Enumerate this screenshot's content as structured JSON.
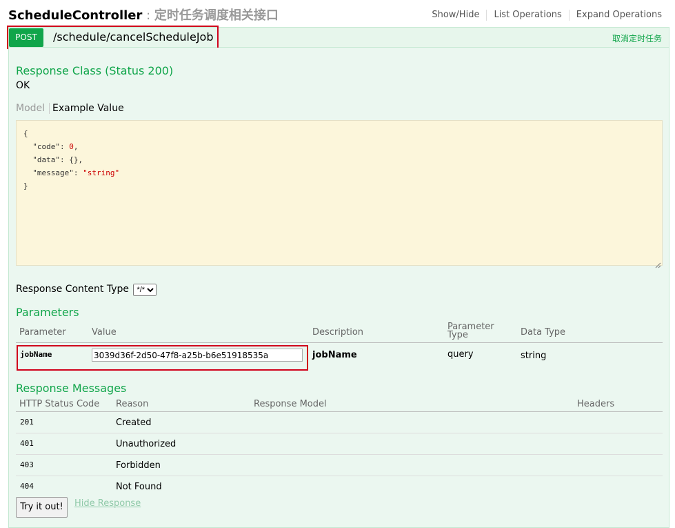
{
  "header": {
    "controller": "ScheduleController",
    "separator": " : ",
    "description": "定时任务调度相关接口",
    "links": [
      "Show/Hide",
      "List Operations",
      "Expand Operations"
    ]
  },
  "operation": {
    "method": "POST",
    "path": "/schedule/cancelScheduleJob",
    "summary": "取消定时任务"
  },
  "response_class": {
    "title": "Response Class (Status 200)",
    "status_text": "OK",
    "tab_model": "Model",
    "tab_example": "Example Value"
  },
  "example_json": {
    "open": "{",
    "code_key": "\"code\"",
    "code_val": "0",
    "data_key": "\"data\"",
    "data_val": "{}",
    "message_key": "\"message\"",
    "message_val": "\"string\"",
    "close": "}"
  },
  "response_content_type": {
    "label": "Response Content Type",
    "selected": "*/*"
  },
  "parameters": {
    "title": "Parameters",
    "headers": {
      "parameter": "Parameter",
      "value": "Value",
      "description": "Description",
      "param_type": "Parameter Type",
      "data_type": "Data Type"
    },
    "rows": [
      {
        "name": "jobName",
        "value": "3039d36f-2d50-47f8-a25b-b6e51918535a",
        "description": "jobName",
        "param_type": "query",
        "data_type": "string"
      }
    ]
  },
  "response_messages": {
    "title": "Response Messages",
    "headers": {
      "code": "HTTP Status Code",
      "reason": "Reason",
      "model": "Response Model",
      "headers": "Headers"
    },
    "rows": [
      {
        "code": "201",
        "reason": "Created"
      },
      {
        "code": "401",
        "reason": "Unauthorized"
      },
      {
        "code": "403",
        "reason": "Forbidden"
      },
      {
        "code": "404",
        "reason": "Not Found"
      }
    ]
  },
  "actions": {
    "try_label": "Try it out!",
    "hide_label": "Hide Response"
  }
}
